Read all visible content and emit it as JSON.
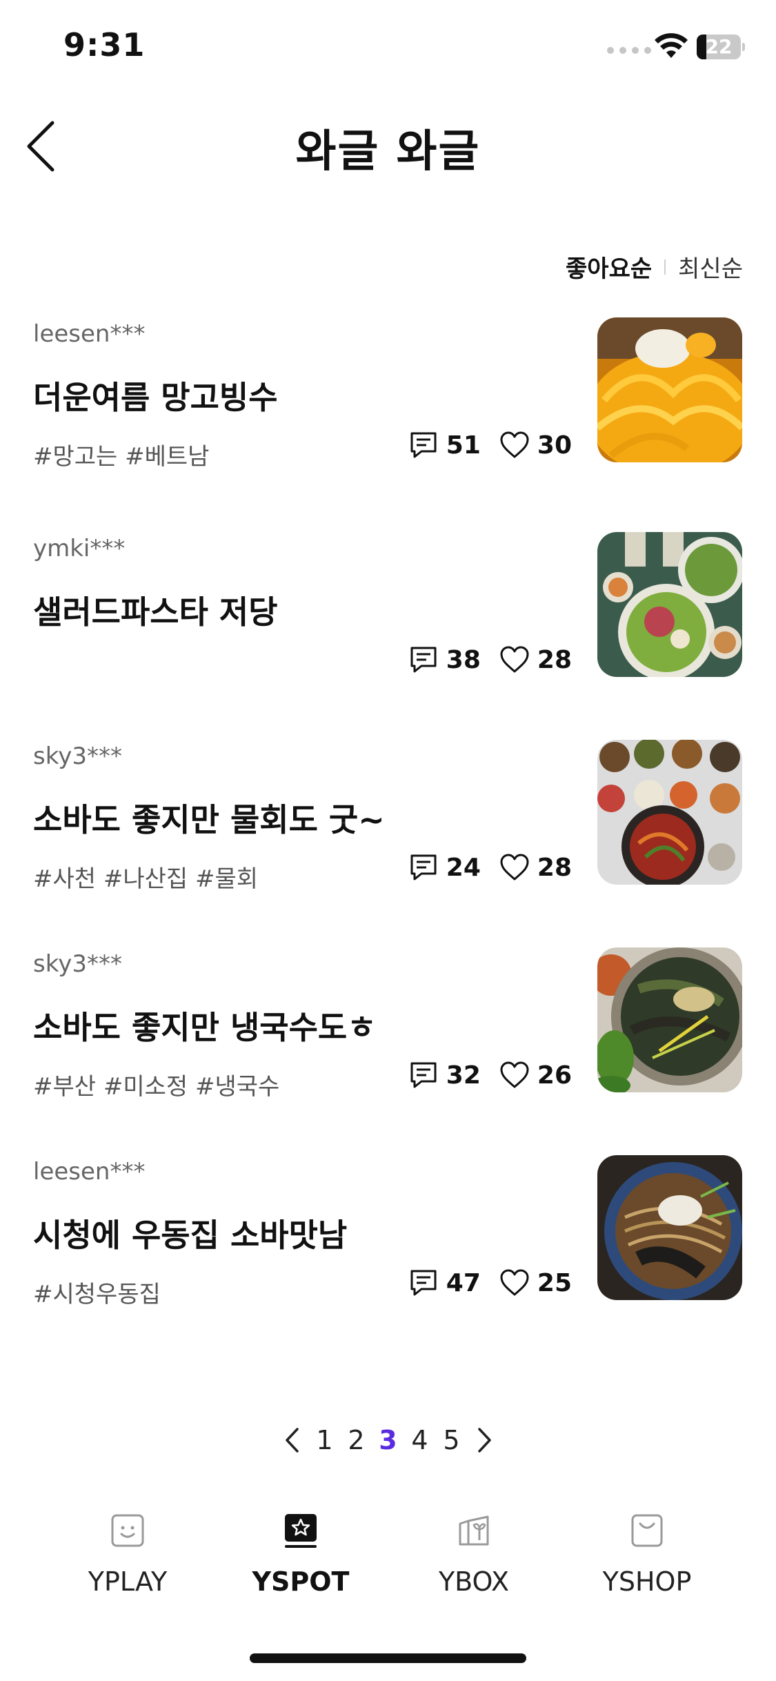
{
  "status_bar": {
    "time": "9:31",
    "battery": "22",
    "battery_level": 0.22
  },
  "header": {
    "title": "와글 와글",
    "back_icon": "chevron-left-icon"
  },
  "sort": {
    "active": "좋아요순",
    "inactive": "최신순"
  },
  "posts": [
    {
      "author": "leesen***",
      "title": "더운여름 망고빙수",
      "tags": "#망고는 #베트남",
      "comments": "51",
      "likes": "30"
    },
    {
      "author": "ymki***",
      "title": "샐러드파스타 저당",
      "tags": "",
      "comments": "38",
      "likes": "28"
    },
    {
      "author": "sky3***",
      "title": "소바도 좋지만 물회도 굿~",
      "tags": "#사천 #나산집 #물회",
      "comments": "24",
      "likes": "28"
    },
    {
      "author": "sky3***",
      "title": "소바도 좋지만 냉국수도ㅎ",
      "tags": "#부산 #미소정 #냉국수",
      "comments": "32",
      "likes": "26"
    },
    {
      "author": "leesen***",
      "title": "시청에 우동집 소바맛남",
      "tags": "#시청우동집",
      "comments": "47",
      "likes": "25"
    }
  ],
  "pagination": {
    "pages": [
      "1",
      "2",
      "3",
      "4",
      "5"
    ],
    "current": "3"
  },
  "tabs": [
    {
      "label": "YPLAY",
      "icon": "smile-square-icon"
    },
    {
      "label": "YSPOT",
      "icon": "star-box-icon"
    },
    {
      "label": "YBOX",
      "icon": "gift-box-icon"
    },
    {
      "label": "YSHOP",
      "icon": "shopping-bag-icon"
    }
  ],
  "colors": {
    "accent": "#5b2be0",
    "text": "#111111",
    "muted": "#666666"
  }
}
